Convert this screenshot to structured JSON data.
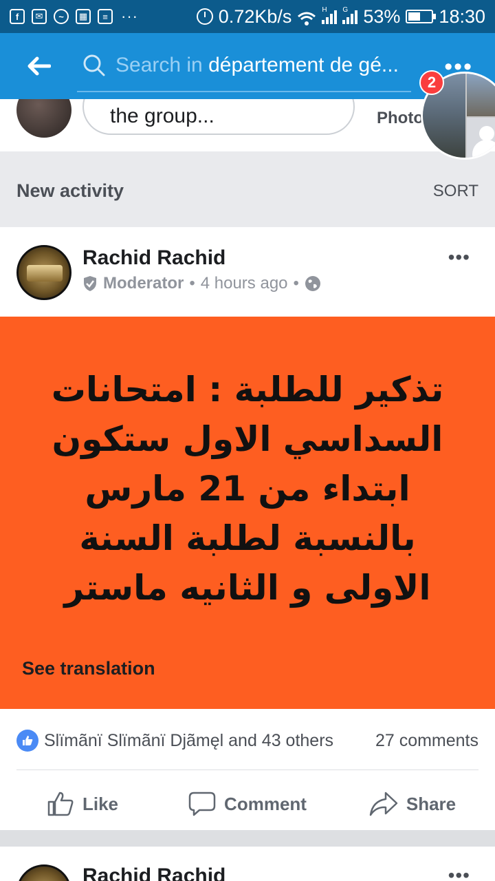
{
  "status_bar": {
    "speed": "0.72Kb/s",
    "battery": "53%",
    "time": "18:30",
    "sim1_label": "H",
    "sim2_label": "G",
    "battery_level": 0.53
  },
  "app_bar": {
    "search_prefix": "Search in ",
    "search_group": "département de gé..."
  },
  "composer": {
    "placeholder": "the group...",
    "photo_label": "Photo"
  },
  "chat_head": {
    "badge": "2"
  },
  "activity": {
    "title": "New activity",
    "sort_label": "SORT"
  },
  "post": {
    "author": "Rachid Rachid",
    "role": "Moderator",
    "time": "4 hours ago",
    "message": "تذكير للطلبة : امتحانات السداسي الاول ستكون ابتداء من 21 مارس بالنسبة لطلبة السنة الاولى و الثانيه ماستر",
    "translate_label": "See translation",
    "card_color": "#fe5e21",
    "reactions_text": "Slïmãnï Slïmãnï Djãmęl and 43 others",
    "comments_text": "27 comments",
    "like_label": "Like",
    "comment_label": "Comment",
    "share_label": "Share"
  },
  "post2": {
    "author": "Rachid Rachid"
  },
  "colors": {
    "status_bar": "#0c5b8c",
    "app_bar": "#1a8fd8",
    "accent_like": "#4a8af5"
  }
}
